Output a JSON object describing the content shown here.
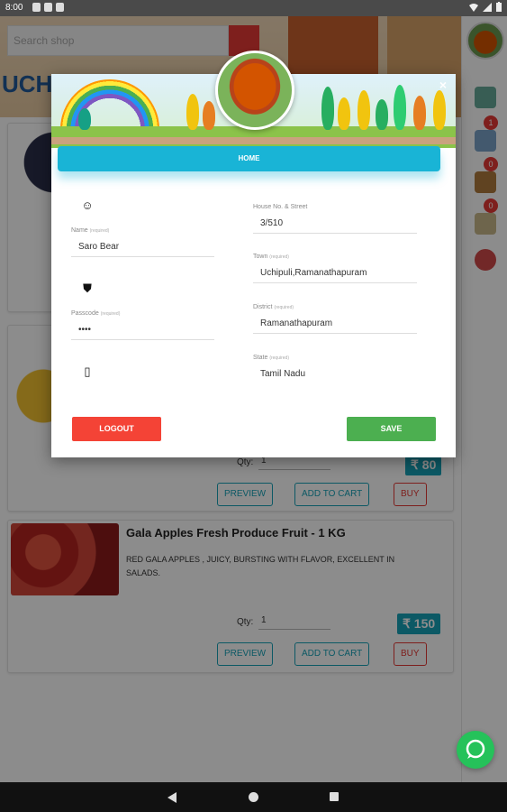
{
  "status_bar": {
    "time": "8:00"
  },
  "background": {
    "search_placeholder": "Search shop",
    "banner_text": "UCHIP",
    "badges": [
      "1",
      "0",
      "0"
    ],
    "products": [
      {
        "title": "",
        "description": "",
        "qty_label": "Qty:",
        "qty_value": "1",
        "price": "₹ 80",
        "preview_label": "PREVIEW",
        "add_to_cart_label": "ADD TO CART",
        "buy_label": "BUY"
      },
      {
        "title": "Gala Apples Fresh Produce Fruit - 1 KG",
        "description": "RED GALA APPLES , JUICY, BURSTING WITH FLAVOR, EXCELLENT IN SALADS.",
        "qty_label": "Qty:",
        "qty_value": "1",
        "price": "₹ 150",
        "preview_label": "PREVIEW",
        "add_to_cart_label": "ADD TO CART",
        "buy_label": "BUY"
      }
    ]
  },
  "modal": {
    "close_label": "×",
    "home_label": "HOME",
    "fields_left": {
      "name": {
        "label": "Name",
        "required": "(required)",
        "value": "Saro Bear"
      },
      "passcode": {
        "label": "Passcode",
        "required": "(required)",
        "value": "••••"
      }
    },
    "fields_right": {
      "house": {
        "label": "House No. & Street",
        "value": "3/510"
      },
      "town": {
        "label": "Town",
        "required": "(required)",
        "value": "Uchipuli,Ramanathapuram"
      },
      "district": {
        "label": "District",
        "required": "(required)",
        "value": "Ramanathapuram"
      },
      "state": {
        "label": "State",
        "required": "(required)",
        "value": "Tamil Nadu"
      }
    },
    "logout_label": "LOGOUT",
    "save_label": "SAVE"
  },
  "colors": {
    "accent": "#19b4d6",
    "logout": "#f44336",
    "save": "#4caf50",
    "price": "#17a2b8",
    "chat": "#25c25a"
  }
}
